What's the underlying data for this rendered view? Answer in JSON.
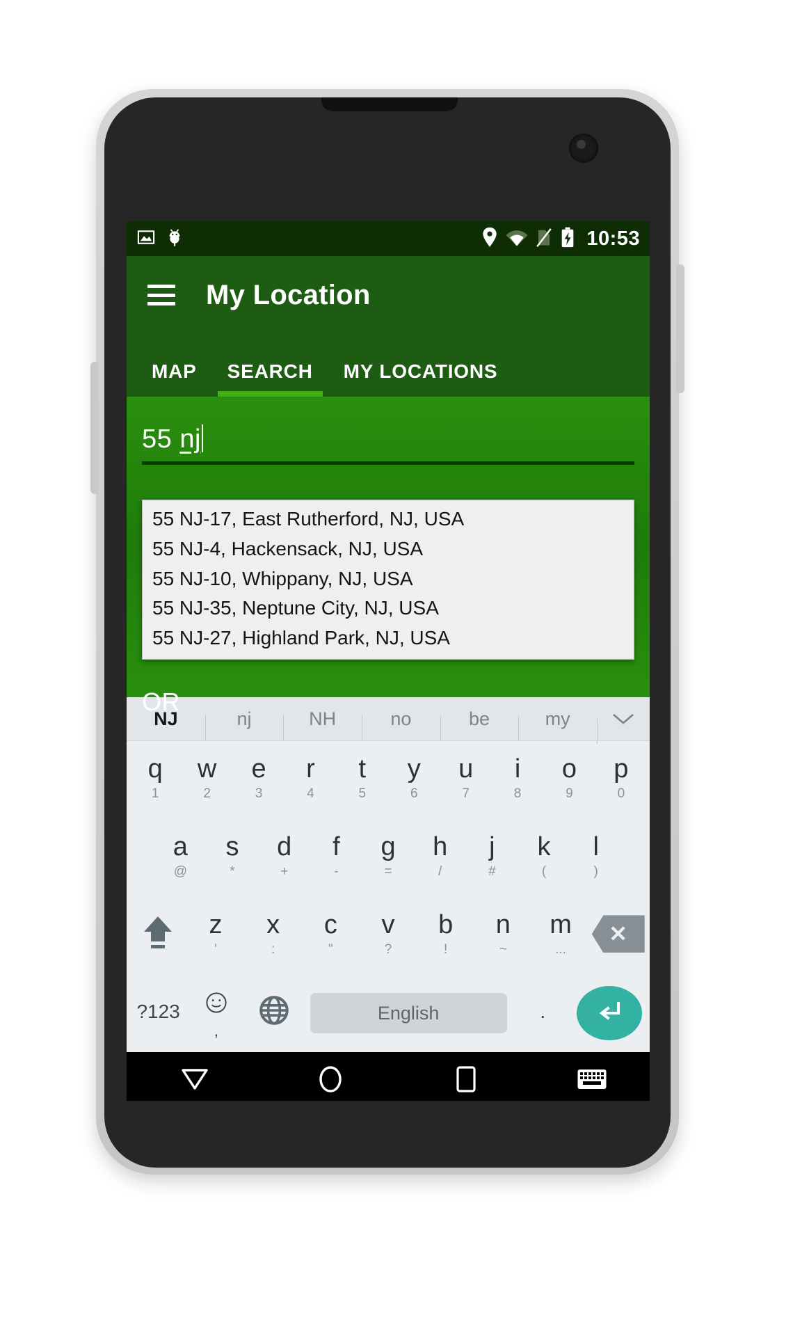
{
  "device": {
    "frame": "android-phone",
    "bezel_color": "#cfcfcf",
    "body_color": "#262626"
  },
  "statusbar": {
    "clock": "10:53",
    "left_icons": [
      "screenshot-image-icon",
      "android-debug-icon"
    ],
    "right_icons": [
      "location-pin-icon",
      "wifi-icon",
      "no-sim-icon",
      "battery-charging-icon"
    ],
    "background": "#0f2d05"
  },
  "appbar": {
    "menu_icon": "hamburger-menu-icon",
    "title": "My Location",
    "background": "#1d5c12",
    "accent": "#3fb014"
  },
  "tabs": {
    "items": [
      {
        "label": "MAP",
        "active": false
      },
      {
        "label": "SEARCH",
        "active": true
      },
      {
        "label": "MY LOCATIONS",
        "active": false
      }
    ]
  },
  "search": {
    "input_value": "55 nj",
    "input_prefix": "55 ",
    "input_composing": "nj",
    "or_label": "OR",
    "suggestions": [
      "55 NJ-17, East Rutherford, NJ, USA",
      "55 NJ-4, Hackensack, NJ, USA",
      "55 NJ-10, Whippany, NJ, USA",
      "55 NJ-35, Neptune City, NJ, USA",
      "55 NJ-27, Highland Park, NJ, USA"
    ],
    "background": "#23830c"
  },
  "keyboard": {
    "suggestion_strip": [
      {
        "text": "NJ",
        "bold": true
      },
      {
        "text": "nj",
        "bold": false
      },
      {
        "text": "NH",
        "bold": false
      },
      {
        "text": "no",
        "bold": false
      },
      {
        "text": "be",
        "bold": false
      },
      {
        "text": "my",
        "bold": false
      }
    ],
    "expand_icon": "chevron-down-icon",
    "row1": [
      {
        "main": "q",
        "sub": "1"
      },
      {
        "main": "w",
        "sub": "2"
      },
      {
        "main": "e",
        "sub": "3"
      },
      {
        "main": "r",
        "sub": "4"
      },
      {
        "main": "t",
        "sub": "5"
      },
      {
        "main": "y",
        "sub": "6"
      },
      {
        "main": "u",
        "sub": "7"
      },
      {
        "main": "i",
        "sub": "8"
      },
      {
        "main": "o",
        "sub": "9"
      },
      {
        "main": "p",
        "sub": "0"
      }
    ],
    "row2": [
      {
        "main": "a",
        "sub": "@"
      },
      {
        "main": "s",
        "sub": "*"
      },
      {
        "main": "d",
        "sub": "+"
      },
      {
        "main": "f",
        "sub": "-"
      },
      {
        "main": "g",
        "sub": "="
      },
      {
        "main": "h",
        "sub": "/"
      },
      {
        "main": "j",
        "sub": "#"
      },
      {
        "main": "k",
        "sub": "("
      },
      {
        "main": "l",
        "sub": ")"
      }
    ],
    "row3": [
      {
        "main": "z",
        "sub": "'"
      },
      {
        "main": "x",
        "sub": ":"
      },
      {
        "main": "c",
        "sub": "\""
      },
      {
        "main": "v",
        "sub": "?"
      },
      {
        "main": "b",
        "sub": "!"
      },
      {
        "main": "n",
        "sub": "~"
      },
      {
        "main": "m",
        "sub": "..."
      }
    ],
    "shift_icon": "shift-arrow-icon",
    "backspace_icon": "backspace-icon",
    "row4": {
      "symbols_label": "?123",
      "emoji_icon": "emoji-smiley-icon",
      "emoji_sub": ",",
      "globe_icon": "language-globe-icon",
      "space_label": "English",
      "period_label": ".",
      "enter_icon": "enter-return-icon",
      "enter_color": "#33b2a4"
    }
  },
  "navbar": {
    "buttons": [
      {
        "icon": "back-down-triangle-icon"
      },
      {
        "icon": "home-circle-icon"
      },
      {
        "icon": "recents-square-icon"
      },
      {
        "icon": "keyboard-toggle-icon"
      }
    ],
    "background": "#000000"
  }
}
